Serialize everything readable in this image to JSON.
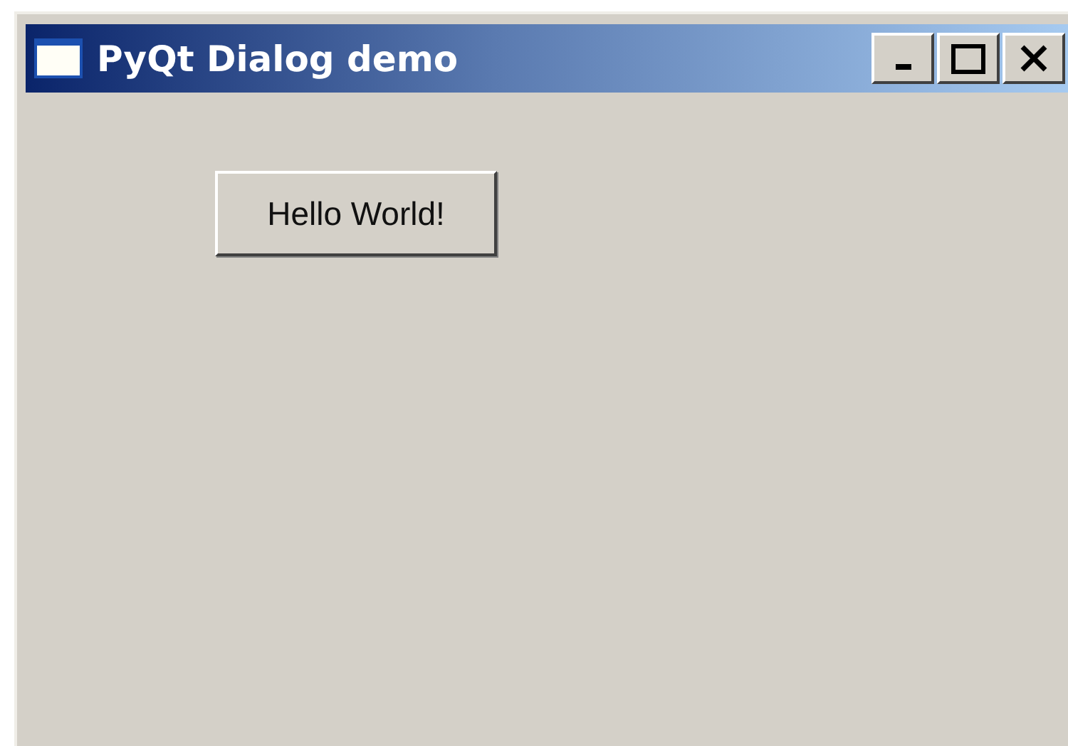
{
  "window": {
    "title": "PyQt Dialog demo"
  },
  "buttons": [
    {
      "label": "Hello World!"
    }
  ]
}
